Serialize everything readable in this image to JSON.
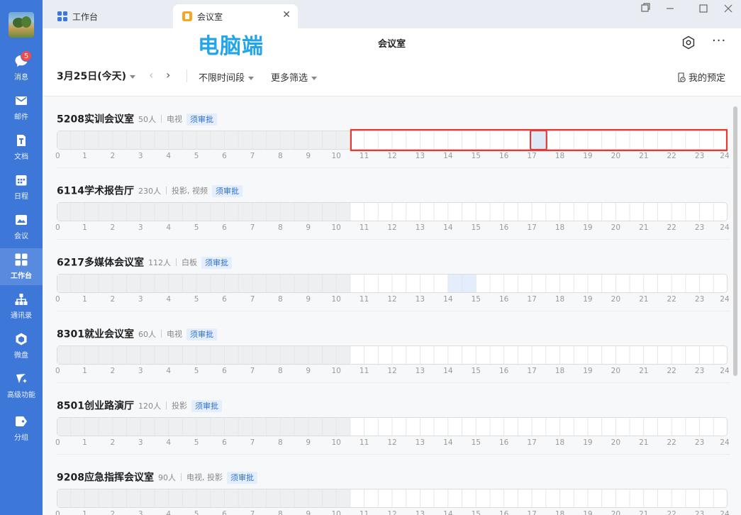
{
  "app": {
    "tabs": [
      {
        "label": "工作台",
        "icon": "grid-apps-icon"
      },
      {
        "label": "会议室",
        "icon": "meeting-room-icon",
        "close": "✕"
      }
    ]
  },
  "sidebar": {
    "badge": "5",
    "items": [
      {
        "label": "消息",
        "icon": "chat-bubble-icon"
      },
      {
        "label": "邮件",
        "icon": "mail-icon"
      },
      {
        "label": "文档",
        "icon": "document-icon"
      },
      {
        "label": "日程",
        "icon": "calendar-icon"
      },
      {
        "label": "会议",
        "icon": "meeting-icon"
      },
      {
        "label": "工作台",
        "icon": "grid-apps-icon",
        "active": true
      },
      {
        "label": "通讯录",
        "icon": "org-chart-icon"
      },
      {
        "label": "微盘",
        "icon": "drive-icon"
      },
      {
        "label": "高级功能",
        "icon": "sparkle-icon"
      },
      {
        "label": "分组",
        "icon": "tag-icon"
      }
    ]
  },
  "header": {
    "watermark": "电脑端",
    "title": "会议室",
    "more": "···"
  },
  "toolbar": {
    "date": "3月25日(今天)",
    "prev": "‹",
    "next": "›",
    "time_filter": "不限时间段",
    "more_filter": "更多筛选",
    "my_booking": "我的预定"
  },
  "axis_labels": [
    "0",
    "1",
    "2",
    "3",
    "4",
    "5",
    "6",
    "7",
    "8",
    "9",
    "10",
    "11",
    "12",
    "13",
    "14",
    "15",
    "16",
    "17",
    "18",
    "19",
    "20",
    "21",
    "22",
    "23",
    "24"
  ],
  "rooms": [
    {
      "name": "5208实训会议室",
      "capacity": "50人",
      "equipment": "电视",
      "tag": "须审批",
      "past_until_hour": 10.5,
      "booked": [],
      "selected_slot": [
        17,
        17.5
      ],
      "highlight_from_hour": 10.5
    },
    {
      "name": "6114学术报告厅",
      "capacity": "230人",
      "equipment": "投影, 视频",
      "tag": "须审批",
      "past_until_hour": 10.5,
      "booked": []
    },
    {
      "name": "6217多媒体会议室",
      "capacity": "112人",
      "equipment": "白板",
      "tag": "须审批",
      "past_until_hour": 10.5,
      "booked": [
        [
          14,
          15
        ]
      ]
    },
    {
      "name": "8301就业会议室",
      "capacity": "60人",
      "equipment": "电视",
      "tag": "须审批",
      "past_until_hour": 10.5,
      "booked": []
    },
    {
      "name": "8501创业路演厅",
      "capacity": "120人",
      "equipment": "投影",
      "tag": "须审批",
      "past_until_hour": 10.5,
      "booked": []
    },
    {
      "name": "9208应急指挥会议室",
      "capacity": "90人",
      "equipment": "电视, 投影",
      "tag": "须审批",
      "past_until_hour": 10.5,
      "booked": []
    }
  ],
  "colors": {
    "sidebar": "#3d77d8",
    "past": "#eeeff1",
    "booked": "#e3edfb",
    "highlight": "#e53935",
    "accent": "#2f6fd8"
  }
}
